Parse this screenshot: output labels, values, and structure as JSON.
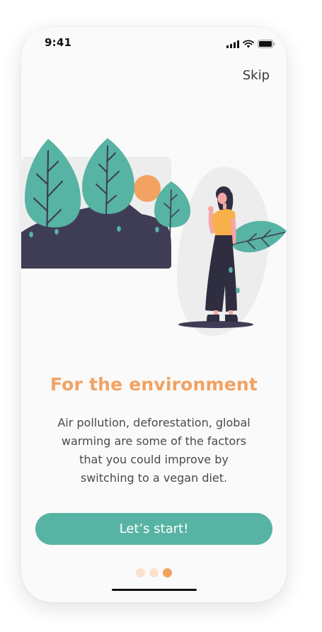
{
  "status_bar": {
    "time": "9:41",
    "icons": [
      "cellular-signal-icon",
      "wifi-icon",
      "battery-icon"
    ]
  },
  "header": {
    "skip_label": "Skip"
  },
  "illustration": {
    "description_icon": "environment-illustration",
    "colors": {
      "leaf": "#57b3a3",
      "hill": "#3f3d56",
      "sun": "#f2a261",
      "shirt": "#f7b04a",
      "pants": "#2f2e41",
      "skin": "#f6a6a6",
      "blob": "#ededed"
    }
  },
  "content": {
    "title": "For the environment",
    "description": "Air pollution, deforestation, global warming are some of the factors that you could improve by switching to a vegan diet."
  },
  "actions": {
    "start_label": "Let’s start!"
  },
  "pagination": {
    "total": 3,
    "active_index": 2
  },
  "theme": {
    "accent": "#57b3a3",
    "title_color": "#f2a261",
    "dot_inactive": "#fbe0cc",
    "dot_active": "#f2a261",
    "background": "#fafafa"
  }
}
